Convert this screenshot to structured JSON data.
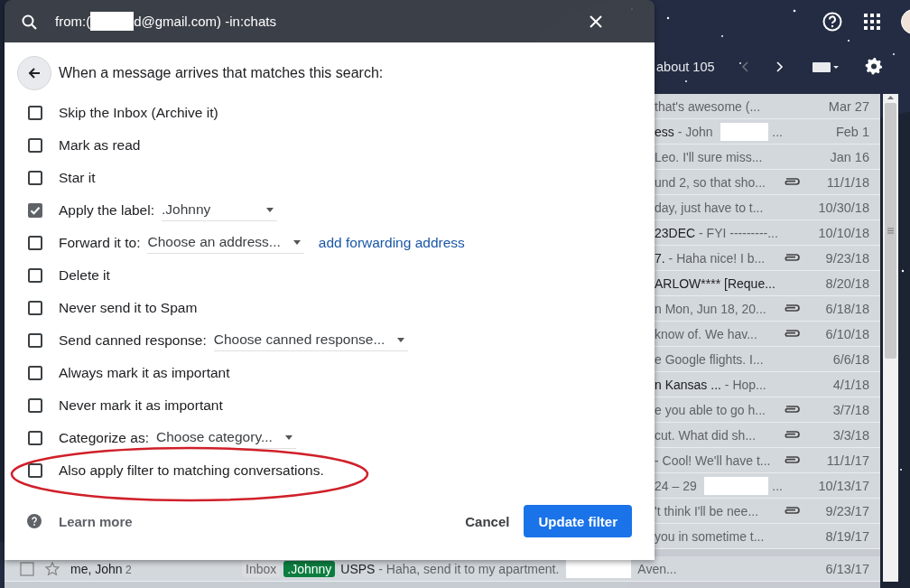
{
  "search": {
    "parts": [
      {
        "kind": "text",
        "text": "from:("
      },
      {
        "kind": "redacted"
      },
      {
        "kind": "text",
        "text": "d@gmail.com) -in:chats"
      }
    ]
  },
  "toolbar": {
    "count": "about 105"
  },
  "filter": {
    "heading": "When a message arrives that matches this search:",
    "options": [
      {
        "kind": "plain",
        "label": "Skip the Inbox (Archive it)",
        "checked": false
      },
      {
        "kind": "plain",
        "label": "Mark as read",
        "checked": false
      },
      {
        "kind": "plain",
        "label": "Star it",
        "checked": false
      },
      {
        "kind": "select",
        "label": "Apply the label:",
        "checked": true,
        "value": ".Johnny"
      },
      {
        "kind": "select",
        "label": "Forward it to:",
        "checked": false,
        "value": "Choose an address...",
        "link": "add forwarding address"
      },
      {
        "kind": "plain",
        "label": "Delete it",
        "checked": false
      },
      {
        "kind": "plain",
        "label": "Never send it to Spam",
        "checked": false
      },
      {
        "kind": "select",
        "label": "Send canned response:",
        "checked": false,
        "value": "Choose canned response..."
      },
      {
        "kind": "plain",
        "label": "Always mark it as important",
        "checked": false
      },
      {
        "kind": "plain",
        "label": "Never mark it as important",
        "checked": false
      },
      {
        "kind": "select",
        "label": "Categorize as:",
        "checked": false,
        "value": "Choose category..."
      },
      {
        "kind": "plain",
        "label": "Also apply filter to matching conversations.",
        "checked": false
      }
    ],
    "learn_more": "Learn more",
    "cancel": "Cancel",
    "submit": "Update filter"
  },
  "annotation": {
    "kind": "ellipse"
  },
  "messages": [
    {
      "kind": "partial",
      "parts": [
        {
          "kind": "snippet",
          "text": "that's awesome (..."
        }
      ],
      "attachment": false,
      "date": "Mar 27"
    },
    {
      "kind": "partial",
      "parts": [
        {
          "kind": "subject",
          "text": "ess"
        },
        {
          "kind": "snippet",
          "text": " - John "
        },
        {
          "kind": "redacted"
        },
        {
          "kind": "snippet",
          "text": "..."
        }
      ],
      "attachment": false,
      "date": "Feb 1"
    },
    {
      "kind": "partial",
      "parts": [
        {
          "kind": "snippet",
          "text": "Leo. I'll sure miss..."
        }
      ],
      "attachment": false,
      "date": "Jan 16"
    },
    {
      "kind": "partial",
      "parts": [
        {
          "kind": "snippet",
          "text": "und 2, so that sho..."
        }
      ],
      "attachment": true,
      "date": "11/1/18"
    },
    {
      "kind": "partial",
      "parts": [
        {
          "kind": "snippet",
          "text": "day, just have to t..."
        }
      ],
      "attachment": false,
      "date": "10/30/18"
    },
    {
      "kind": "partial",
      "parts": [
        {
          "kind": "subject",
          "text": "23DEC"
        },
        {
          "kind": "snippet",
          "text": " - FYI ---------..."
        }
      ],
      "attachment": false,
      "date": "10/10/18"
    },
    {
      "kind": "partial",
      "parts": [
        {
          "kind": "subject",
          "text": "7."
        },
        {
          "kind": "snippet",
          "text": " - Haha nice! I b..."
        }
      ],
      "attachment": true,
      "date": "9/23/18"
    },
    {
      "kind": "partial",
      "parts": [
        {
          "kind": "subject",
          "text": "ARLOW**** [Reque..."
        }
      ],
      "attachment": false,
      "date": "8/20/18"
    },
    {
      "kind": "partial",
      "parts": [
        {
          "kind": "snippet",
          "text": "n Mon, Jun 18, 20..."
        }
      ],
      "attachment": true,
      "date": "6/18/18"
    },
    {
      "kind": "partial",
      "parts": [
        {
          "kind": "snippet",
          "text": "know of. We hav..."
        }
      ],
      "attachment": true,
      "date": "6/10/18"
    },
    {
      "kind": "partial",
      "parts": [
        {
          "kind": "snippet",
          "text": "e Google flights. I..."
        }
      ],
      "attachment": false,
      "date": "6/6/18"
    },
    {
      "kind": "partial",
      "parts": [
        {
          "kind": "subject",
          "text": "n Kansas ..."
        },
        {
          "kind": "snippet",
          "text": " - Hop..."
        }
      ],
      "attachment": false,
      "date": "4/1/18"
    },
    {
      "kind": "partial",
      "parts": [
        {
          "kind": "snippet",
          "text": "e you able to go h..."
        }
      ],
      "attachment": true,
      "date": "3/7/18"
    },
    {
      "kind": "partial",
      "parts": [
        {
          "kind": "snippet",
          "text": "cut. What did sh..."
        }
      ],
      "attachment": true,
      "date": "3/3/18"
    },
    {
      "kind": "partial",
      "parts": [
        {
          "kind": "snippet",
          "text": "- Cool! We'll have t..."
        }
      ],
      "attachment": true,
      "date": "11/1/17"
    },
    {
      "kind": "partial",
      "parts": [
        {
          "kind": "snippet",
          "text": "24 – 29 "
        },
        {
          "kind": "redacted"
        },
        {
          "kind": "snippet",
          "text": "..."
        }
      ],
      "attachment": false,
      "date": "10/13/17"
    },
    {
      "kind": "partial",
      "parts": [
        {
          "kind": "snippet",
          "text": "'t think I'll be nee..."
        }
      ],
      "attachment": true,
      "date": "9/23/17"
    },
    {
      "kind": "partial",
      "parts": [
        {
          "kind": "snippet",
          "text": "you in sometime t..."
        }
      ],
      "attachment": false,
      "date": "8/19/17"
    },
    {
      "kind": "full",
      "checked": false,
      "starred": false,
      "sender": "me, John",
      "count": "2",
      "labels": [
        {
          "text": "Inbox",
          "color": "#dadce0"
        },
        {
          "text": ".Johnny",
          "color": "#0b7d3e"
        }
      ],
      "parts": [
        {
          "kind": "subject",
          "text": "USPS"
        },
        {
          "kind": "snippet",
          "text": " - Haha, send it to my apartment. "
        },
        {
          "kind": "redacted"
        },
        {
          "kind": "snippet",
          "text": " Aven..."
        }
      ],
      "attachment": false,
      "date": "6/13/17"
    }
  ]
}
